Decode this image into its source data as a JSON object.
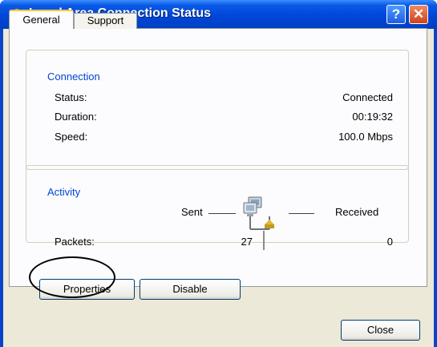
{
  "window": {
    "title": "Local Area Connection Status"
  },
  "tabs": [
    {
      "label": "General",
      "selected": true
    },
    {
      "label": "Support",
      "selected": false
    }
  ],
  "connection": {
    "legend": "Connection",
    "rows": [
      {
        "label": "Status:",
        "value": "Connected"
      },
      {
        "label": "Duration:",
        "value": "00:19:32"
      },
      {
        "label": "Speed:",
        "value": "100.0 Mbps"
      }
    ]
  },
  "activity": {
    "legend": "Activity",
    "sent_label": "Sent",
    "received_label": "Received",
    "packets_label": "Packets:",
    "packets_sent": "27",
    "packets_received": "0"
  },
  "buttons": {
    "properties": "Properties",
    "disable": "Disable",
    "close": "Close"
  },
  "icons": {
    "title": "network-connection-icon",
    "activity": "network-activity-icon"
  },
  "colors": {
    "titlebar": "#0046d8",
    "dialog_bg": "#ece9d8",
    "legend_text": "#0046d5",
    "close_button": "#d0421b"
  }
}
